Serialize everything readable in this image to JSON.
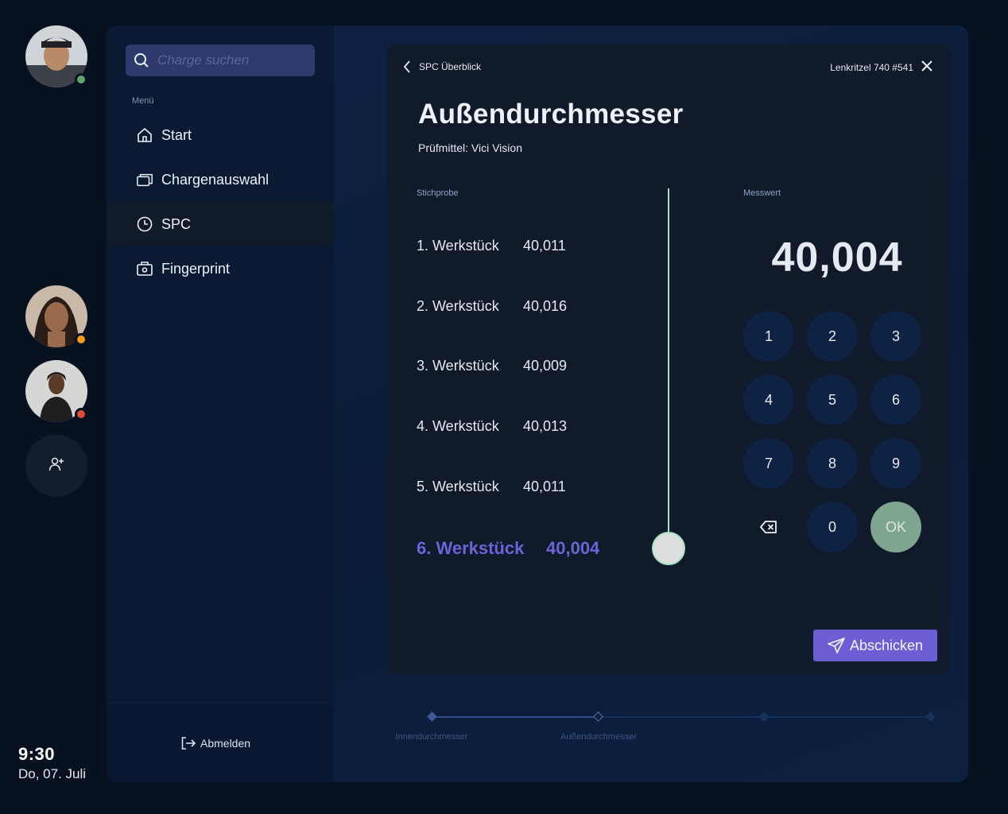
{
  "users": [
    {
      "name": "user-1",
      "status": "online",
      "status_color": "#5fa870"
    },
    {
      "name": "user-2",
      "status": "away",
      "status_color": "#f39c1e"
    },
    {
      "name": "user-3",
      "status": "busy",
      "status_color": "#e0483a"
    }
  ],
  "clock": {
    "time": "9:30",
    "date": "Do, 07. Juli"
  },
  "search": {
    "placeholder": "Charge suchen"
  },
  "sidebar": {
    "menu_label": "Menü",
    "items": [
      {
        "label": "Start",
        "icon": "home-icon"
      },
      {
        "label": "Chargenauswahl",
        "icon": "windows-icon"
      },
      {
        "label": "SPC",
        "icon": "clock-icon",
        "active": true
      },
      {
        "label": "Fingerprint",
        "icon": "camera-icon"
      }
    ],
    "logout_label": "Abmelden"
  },
  "card": {
    "back_label": "SPC Überblick",
    "context_label": "Lenkritzel 740 #541",
    "title": "Außendurchmesser",
    "subtitle": "Prüfmittel: Vici Vision",
    "sample_label": "Stichprobe",
    "reading_label": "Messwert",
    "samples": [
      {
        "name": "1. Werkstück",
        "value": "40,011"
      },
      {
        "name": "2. Werkstück",
        "value": "40,016"
      },
      {
        "name": "3. Werkstück",
        "value": "40,009"
      },
      {
        "name": "4. Werkstück",
        "value": "40,013"
      },
      {
        "name": "5. Werkstück",
        "value": "40,011"
      },
      {
        "name": "6. Werkstück",
        "value": "40,004"
      }
    ],
    "reading": "40,004",
    "keypad": [
      "1",
      "2",
      "3",
      "4",
      "5",
      "6",
      "7",
      "8",
      "9",
      "",
      "0",
      "OK"
    ],
    "submit_label": "Abschicken"
  },
  "stepper": {
    "steps": [
      "Innendurchmesser",
      "Außendurchmesser",
      "",
      ""
    ],
    "current_step": 2
  },
  "colors": {
    "accent": "#6c5fd6",
    "slider": "#a7e3c2",
    "ok": "#7ea58e"
  }
}
